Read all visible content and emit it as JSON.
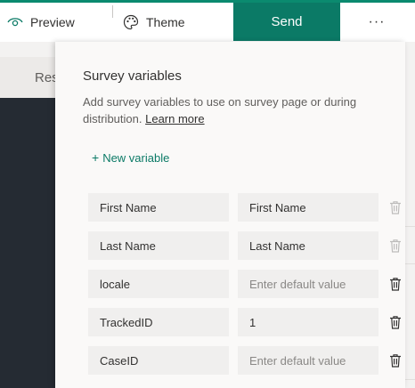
{
  "toolbar": {
    "preview_label": "Preview",
    "theme_label": "Theme",
    "send_label": "Send",
    "more_label": "···",
    "accent": "#0b7a66"
  },
  "background": {
    "tab_label": "Res"
  },
  "panel": {
    "title": "Survey variables",
    "description": "Add survey variables to use on survey page or during distribution.",
    "learn_more": "Learn more",
    "new_variable_label": "New variable",
    "rows": [
      {
        "name": "First Name",
        "value": "First Name",
        "placeholder": "",
        "delete_enabled": false
      },
      {
        "name": "Last Name",
        "value": "Last Name",
        "placeholder": "",
        "delete_enabled": false
      },
      {
        "name": "locale",
        "value": "",
        "placeholder": "Enter default value",
        "delete_enabled": true
      },
      {
        "name": "TrackedID",
        "value": "1",
        "placeholder": "",
        "delete_enabled": true
      },
      {
        "name": "CaseID",
        "value": "",
        "placeholder": "Enter default value",
        "delete_enabled": true
      }
    ]
  }
}
